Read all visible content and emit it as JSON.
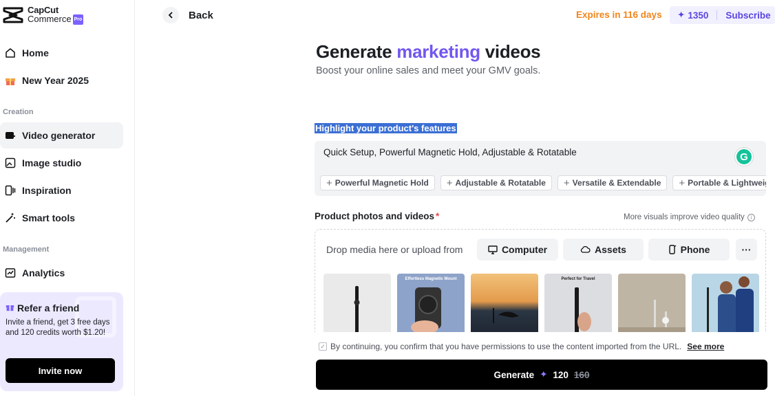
{
  "app": {
    "logo_line1": "CapCut",
    "logo_line2": "Commerce",
    "logo_badge": "Pro"
  },
  "sidebar": {
    "items": [
      {
        "label": "Home",
        "icon": "home-icon"
      },
      {
        "label": "New Year 2025",
        "icon": "gift-icon"
      },
      {
        "label": "Video generator",
        "icon": "video-generator-icon",
        "active": true
      },
      {
        "label": "Image studio",
        "icon": "image-studio-icon"
      },
      {
        "label": "Inspiration",
        "icon": "inspiration-icon"
      },
      {
        "label": "Smart tools",
        "icon": "magic-wand-icon"
      },
      {
        "label": "Analytics",
        "icon": "analytics-icon"
      }
    ],
    "section_creation": "Creation",
    "section_management": "Management",
    "refer": {
      "title": "Refer a friend",
      "text": "Invite a friend, get 3 free days and 120 credits worth $1.20!",
      "button": "Invite now"
    }
  },
  "header": {
    "back_label": "Back",
    "expires": "Expires in 116 days",
    "credits": "1350",
    "subscribe": "Subscribe"
  },
  "main": {
    "title_part1": "Generate",
    "title_accent": "marketing",
    "title_part2": "videos",
    "subtitle": "Boost your online sales and meet your GMV goals.",
    "features_label": "Highlight your product's features",
    "features_value": "Quick Setup, Powerful Magnetic Hold, Adjustable & Rotatable",
    "chips": [
      "Powerful Magnetic Hold",
      "Adjustable & Rotatable",
      "Versatile & Extendable",
      "Portable & Lightweight"
    ],
    "media_label": "Product photos and videos",
    "media_required": "*",
    "more_visuals": "More visuals improve video quality",
    "drop_text": "Drop media here or upload from",
    "upload_buttons": [
      "Computer",
      "Assets",
      "Phone"
    ],
    "more_button": "···",
    "thumbs": [
      {
        "caption": ""
      },
      {
        "caption": "Effortless Magnetic Mount"
      },
      {
        "caption": ""
      },
      {
        "caption": "Perfect for Travel"
      },
      {
        "caption": ""
      },
      {
        "caption": ""
      }
    ],
    "consent_text": "By continuing, you confirm that you have permissions to use the content imported from the URL.",
    "see_more": "See more",
    "generate_label": "Generate",
    "generate_cost": "120",
    "generate_old_cost": "160"
  },
  "colors": {
    "accent": "#7257f0",
    "expires": "#f0851b",
    "credit_text": "#5a46e0",
    "grammarly": "#15c39a"
  }
}
